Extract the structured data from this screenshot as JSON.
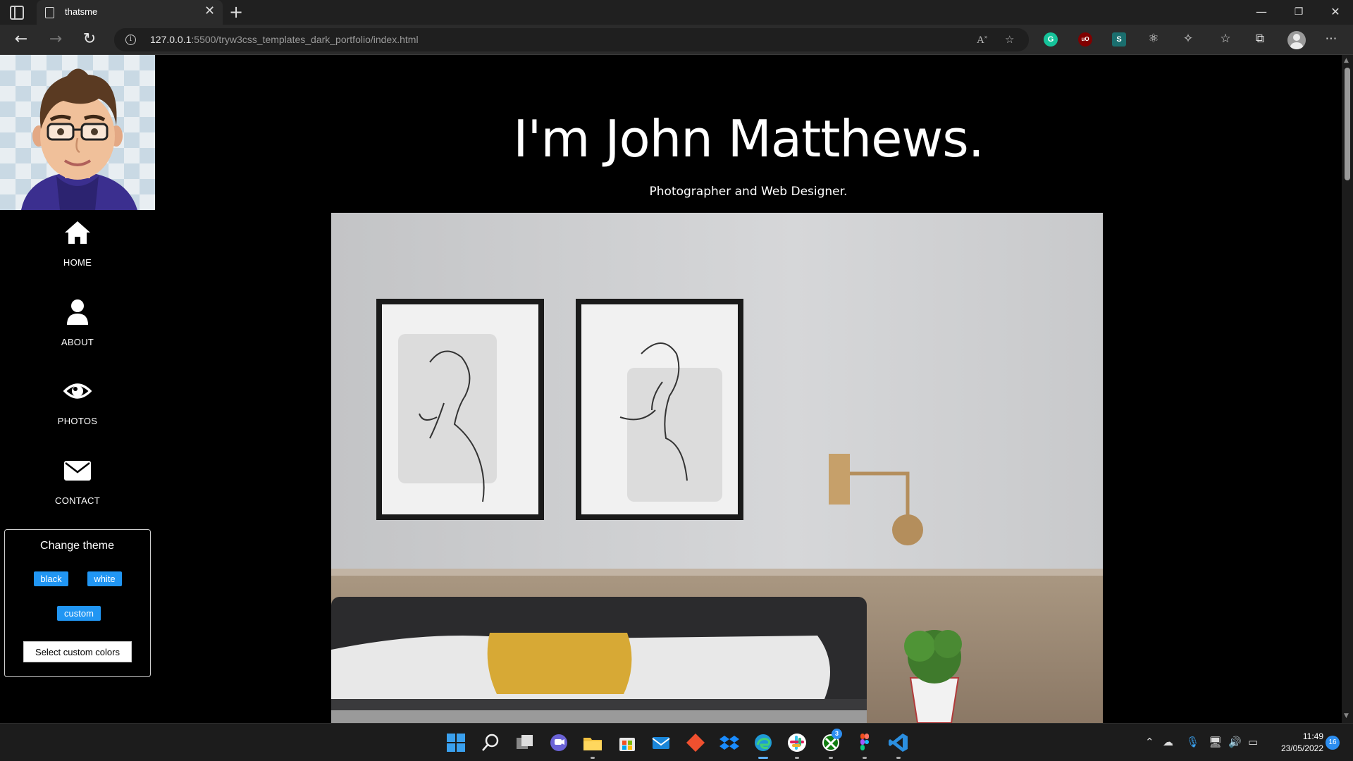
{
  "browser": {
    "tab_title": "thatsme",
    "url_host": "127.0.0.1",
    "url_rest": ":5500/tryw3css_templates_dark_portfolio/index.html"
  },
  "sidebar": {
    "nav": [
      {
        "label": "HOME",
        "icon": "home-icon"
      },
      {
        "label": "ABOUT",
        "icon": "user-icon"
      },
      {
        "label": "PHOTOS",
        "icon": "eye-icon"
      },
      {
        "label": "CONTACT",
        "icon": "envelope-icon"
      }
    ],
    "theme": {
      "title": "Change theme",
      "buttons": [
        "black",
        "white",
        "custom"
      ],
      "custom_colors_label": "Select custom colors",
      "accent": "#2196f3"
    }
  },
  "main": {
    "title": "I'm John Matthews.",
    "subtitle": "Photographer and Web Designer."
  },
  "taskbar": {
    "time": "11:49",
    "date": "23/05/2022",
    "notifications": "16",
    "xbox_badge": "3"
  }
}
